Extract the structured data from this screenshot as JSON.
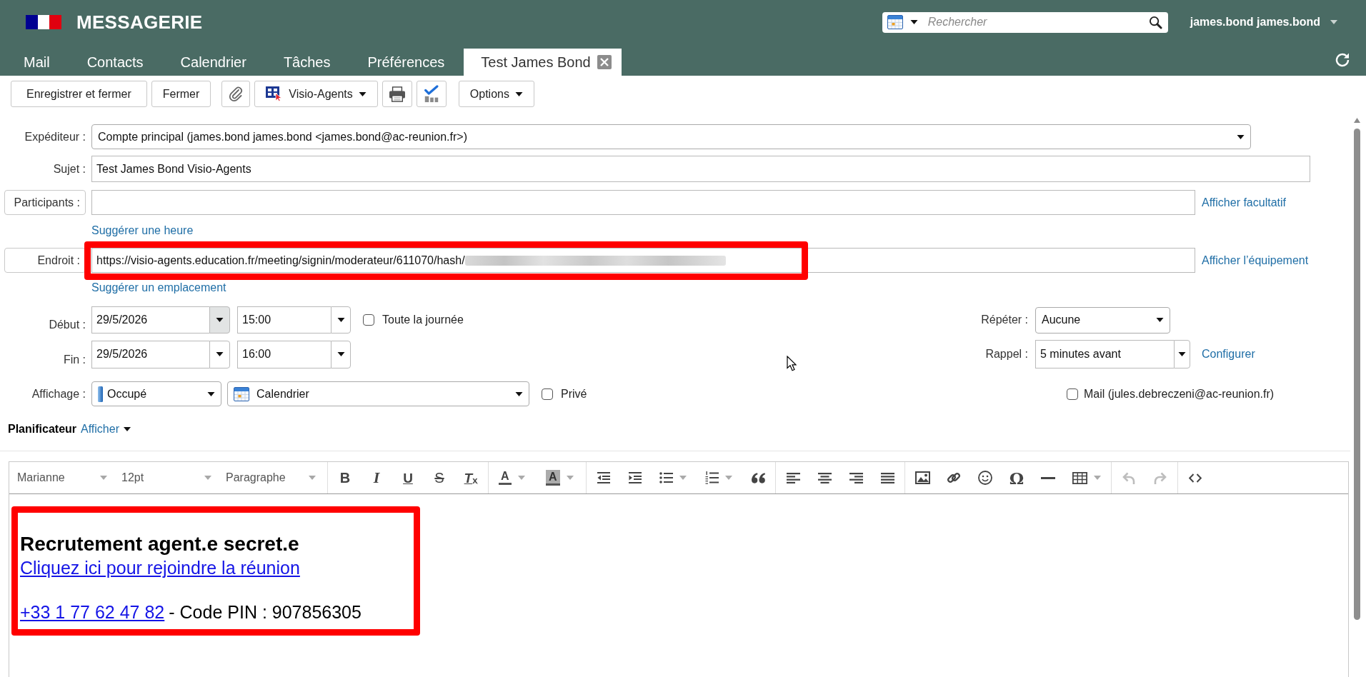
{
  "header": {
    "title": "MESSAGERIE",
    "search": {
      "placeholder": "Rechercher"
    },
    "user": "james.bond james.bond"
  },
  "tabs": [
    {
      "label": "Mail",
      "selected": false,
      "closable": false
    },
    {
      "label": "Contacts",
      "selected": false,
      "closable": false
    },
    {
      "label": "Calendrier",
      "selected": false,
      "closable": false
    },
    {
      "label": "Tâches",
      "selected": false,
      "closable": false
    },
    {
      "label": "Préférences",
      "selected": false,
      "closable": false
    },
    {
      "label": "Test James Bond",
      "selected": true,
      "closable": true
    }
  ],
  "toolbar": {
    "save_close": "Enregistrer et fermer",
    "close": "Fermer",
    "visio": "Visio-Agents",
    "options": "Options"
  },
  "form": {
    "sender": {
      "label": "Expéditeur :",
      "value": "Compte principal (james.bond james.bond <james.bond@ac-reunion.fr>)"
    },
    "subject": {
      "label": "Sujet :",
      "value": "Test James Bond Visio-Agents"
    },
    "participants": {
      "label": "Participants :",
      "link": "Afficher facultatif",
      "suggest": "Suggérer une heure"
    },
    "location": {
      "label": "Endroit :",
      "value": "https://visio-agents.education.fr/meeting/signin/moderateur/611070/hash/",
      "redacted": true,
      "highlighted": true,
      "link": "Afficher l’équipement",
      "suggest": "Suggérer un emplacement"
    },
    "start": {
      "label": "Début :",
      "date": "29/5/2026",
      "time": "15:00",
      "date_dropdown_highlighted": true
    },
    "end": {
      "label": "Fin :",
      "date": "29/5/2026",
      "time": "16:00",
      "date_dropdown_highlighted": false
    },
    "all_day": {
      "label": "Toute la journée",
      "checked": false
    },
    "repeat": {
      "label": "Répéter :",
      "value": "Aucune"
    },
    "reminder": {
      "label": "Rappel :",
      "value": "5 minutes avant",
      "link": "Configurer"
    },
    "show_as": {
      "label": "Affichage :",
      "value": "Occupé",
      "calendar": "Calendrier"
    },
    "private": {
      "label": "Privé",
      "checked": false
    },
    "notify_mail": {
      "label": "Mail (jules.debreczeni@ac-reunion.fr)",
      "checked": false
    },
    "scheduler": {
      "label": "Planificateur",
      "link": "Afficher"
    }
  },
  "editor": {
    "toolbar": {
      "font": "Marianne",
      "size": "12pt",
      "block": "Paragraphe",
      "bold": "B",
      "italic": "I",
      "underline": "U",
      "strikethrough": "S",
      "clear_formatting": "T$_{x}$",
      "text_color": "A",
      "background_color": "A",
      "special_character": "Ω",
      "undo": {
        "disabled": true
      },
      "redo": {
        "disabled": true
      }
    },
    "content": {
      "highlighted": true,
      "heading": "Recrutement agent.e secret.e",
      "join_link": "Cliquez ici pour rejoindre la réunion",
      "phone": "+33 1 77 62 47 82",
      "pin": "- Code PIN : 907856305"
    }
  }
}
